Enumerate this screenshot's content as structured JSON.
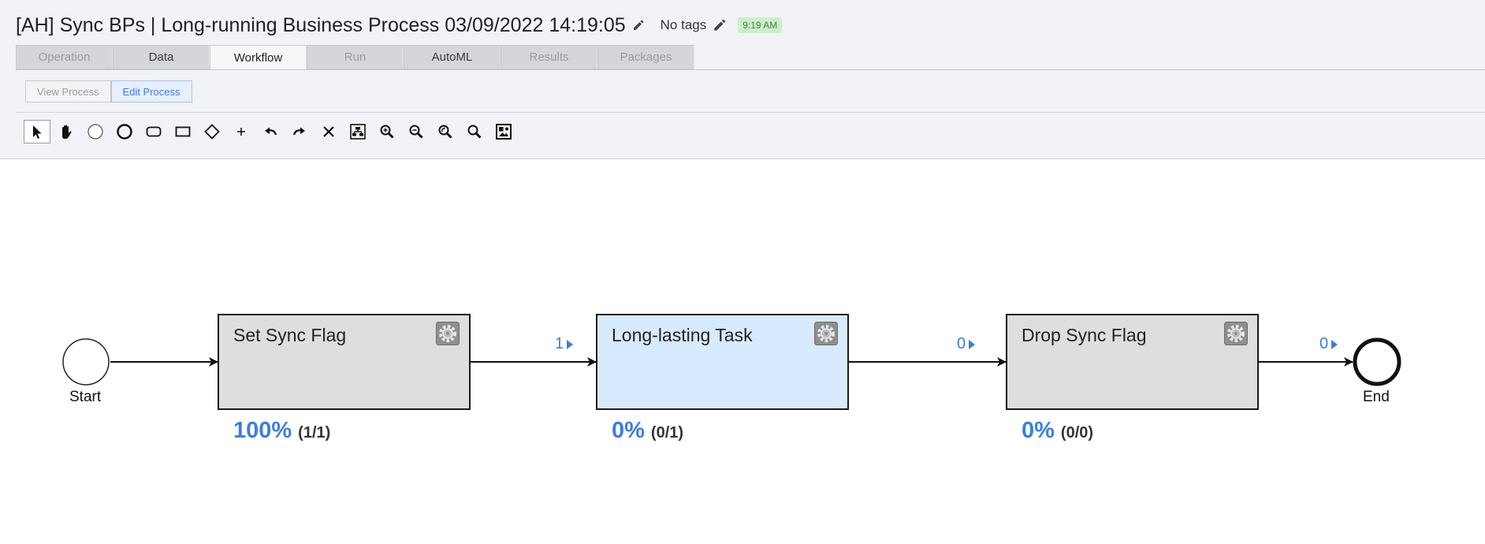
{
  "header": {
    "title": "[AH] Sync BPs | Long-running Business Process 03/09/2022 14:19:05",
    "tags_text": "No tags",
    "time_badge": "9:19 AM",
    "badge_color": "#cdeec9"
  },
  "tabs": [
    {
      "label": "Operation",
      "state": "disabled"
    },
    {
      "label": "Data",
      "state": "enabled"
    },
    {
      "label": "Workflow",
      "state": "active"
    },
    {
      "label": "Run",
      "state": "disabled"
    },
    {
      "label": "AutoML",
      "state": "enabled"
    },
    {
      "label": "Results",
      "state": "disabled"
    },
    {
      "label": "Packages",
      "state": "disabled"
    }
  ],
  "subtabs": [
    {
      "label": "View Process",
      "active": false
    },
    {
      "label": "Edit Process",
      "active": true
    }
  ],
  "toolbar": [
    {
      "icon": "pointer-icon",
      "selected": true
    },
    {
      "icon": "hand-icon",
      "selected": false
    },
    {
      "icon": "start-event-icon",
      "selected": false
    },
    {
      "icon": "end-event-icon",
      "selected": false
    },
    {
      "icon": "subprocess-icon",
      "selected": false
    },
    {
      "icon": "task-icon",
      "selected": false
    },
    {
      "icon": "gateway-icon",
      "selected": false
    },
    {
      "icon": "plus-icon",
      "selected": false
    },
    {
      "icon": "undo-icon",
      "selected": false
    },
    {
      "icon": "redo-icon",
      "selected": false
    },
    {
      "icon": "delete-icon",
      "selected": false
    },
    {
      "icon": "auto-layout-icon",
      "selected": false
    },
    {
      "icon": "zoom-in-icon",
      "selected": false
    },
    {
      "icon": "zoom-out-icon",
      "selected": false
    },
    {
      "icon": "zoom-reset-icon",
      "selected": false
    },
    {
      "icon": "zoom-fit-icon",
      "selected": false
    },
    {
      "icon": "export-image-icon",
      "selected": false
    }
  ],
  "process": {
    "start_label": "Start",
    "end_label": "End",
    "tasks": [
      {
        "label": "Set Sync Flag",
        "percent": "100%",
        "count": "(1/1)",
        "state": "done"
      },
      {
        "label": "Long-lasting Task",
        "percent": "0%",
        "count": "(0/1)",
        "state": "running"
      },
      {
        "label": "Drop Sync Flag",
        "percent": "0%",
        "count": "(0/0)",
        "state": "pending"
      }
    ],
    "edge_counts": [
      "1",
      "0",
      "0"
    ],
    "accent_color": "#3b7fdd",
    "running_color": "#d8eafd",
    "idle_color": "#dedede"
  }
}
